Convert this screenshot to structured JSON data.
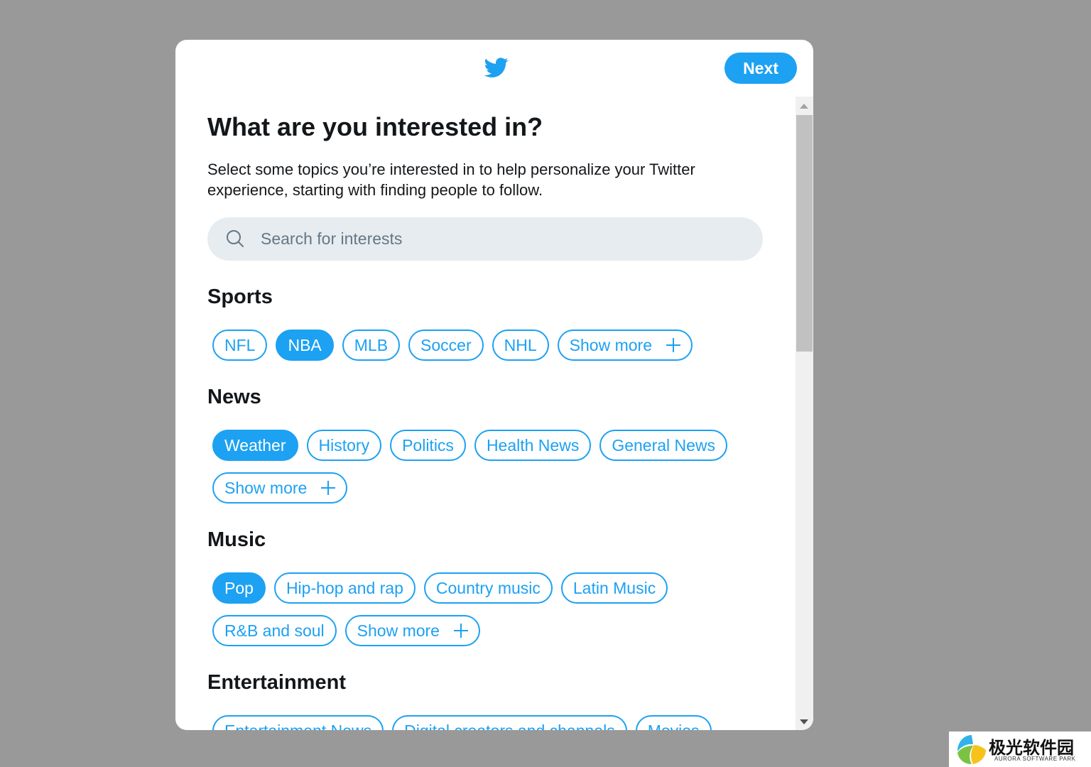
{
  "header": {
    "logo_icon": "twitter-bird-icon",
    "next_label": "Next"
  },
  "main": {
    "title": "What are you interested in?",
    "subtitle": "Select some topics you’re interested in to help personalize your Twitter experience, starting with finding people to follow.",
    "search": {
      "placeholder": "Search for interests",
      "value": "",
      "icon": "search-icon"
    }
  },
  "sections": [
    {
      "title": "Sports",
      "chips": [
        {
          "label": "NFL",
          "selected": false
        },
        {
          "label": "NBA",
          "selected": true
        },
        {
          "label": "MLB",
          "selected": false
        },
        {
          "label": "Soccer",
          "selected": false
        },
        {
          "label": "NHL",
          "selected": false
        }
      ],
      "show_more": "Show more"
    },
    {
      "title": "News",
      "chips": [
        {
          "label": "Weather",
          "selected": true
        },
        {
          "label": "History",
          "selected": false
        },
        {
          "label": "Politics",
          "selected": false
        },
        {
          "label": "Health News",
          "selected": false
        },
        {
          "label": "General News",
          "selected": false
        }
      ],
      "show_more": "Show more"
    },
    {
      "title": "Music",
      "chips": [
        {
          "label": "Pop",
          "selected": true
        },
        {
          "label": "Hip-hop and rap",
          "selected": false
        },
        {
          "label": "Country music",
          "selected": false
        },
        {
          "label": "Latin Music",
          "selected": false
        },
        {
          "label": "R&B and soul",
          "selected": false
        }
      ],
      "show_more": "Show more"
    },
    {
      "title": "Entertainment",
      "chips": [
        {
          "label": "Entertainment News",
          "selected": false
        },
        {
          "label": "Digital creators and channels",
          "selected": false
        },
        {
          "label": "Movies",
          "selected": false
        }
      ]
    }
  ],
  "colors": {
    "accent": "#1da1f2",
    "text": "#14171a",
    "muted": "#657786",
    "search_bg": "#e6ecf0",
    "backdrop": "#999999"
  },
  "watermark": {
    "text": "极光软件园",
    "subtext": "AURORA SOFTWARE PARK"
  }
}
